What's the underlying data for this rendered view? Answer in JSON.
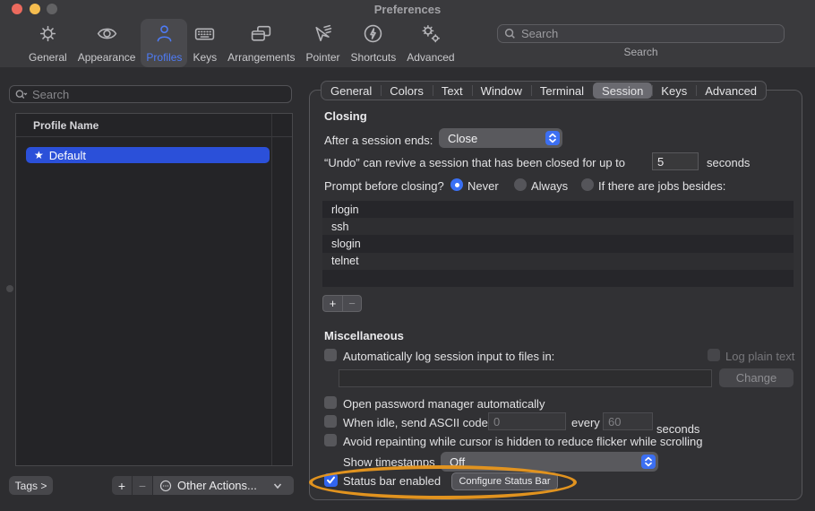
{
  "window": {
    "title": "Preferences"
  },
  "toolbar": {
    "items": [
      {
        "label": "General",
        "icon": "gear-icon",
        "selected": false
      },
      {
        "label": "Appearance",
        "icon": "eye-icon",
        "selected": false
      },
      {
        "label": "Profiles",
        "icon": "person-icon",
        "selected": true
      },
      {
        "label": "Keys",
        "icon": "keyboard-icon",
        "selected": false
      },
      {
        "label": "Arrangements",
        "icon": "windows-icon",
        "selected": false
      },
      {
        "label": "Pointer",
        "icon": "cursor-icon",
        "selected": false
      },
      {
        "label": "Shortcuts",
        "icon": "lightning-icon",
        "selected": false
      },
      {
        "label": "Advanced",
        "icon": "double-gear-icon",
        "selected": false
      }
    ],
    "search": {
      "placeholder": "Search",
      "caption": "Search"
    }
  },
  "sidebar": {
    "search_placeholder": "Search",
    "column_header": "Profile Name",
    "profiles": [
      {
        "star": "★",
        "name": "Default",
        "selected": true
      }
    ],
    "tags_button": "Tags >",
    "add_label": "+",
    "remove_label": "−",
    "other_actions_label": "Other Actions..."
  },
  "panel": {
    "tabs": [
      "General",
      "Colors",
      "Text",
      "Window",
      "Terminal",
      "Session",
      "Keys",
      "Advanced"
    ],
    "selected_tab": "Session",
    "closing": {
      "heading": "Closing",
      "after_label": "After a session ends:",
      "after_value": "Close",
      "undo_text": "“Undo” can revive a session that has been closed for up to",
      "undo_value": "5",
      "undo_suffix": "seconds",
      "prompt_label": "Prompt before closing?",
      "prompt_options": [
        "Never",
        "Always",
        "If there are jobs besides:"
      ],
      "prompt_selected": "Never",
      "jobs": [
        "rlogin",
        "ssh",
        "slogin",
        "telnet"
      ],
      "list_add": "+",
      "list_remove": "−"
    },
    "misc": {
      "heading": "Miscellaneous",
      "auto_log_label": "Automatically log session input to files in:",
      "log_plain_text_label": "Log plain text",
      "log_dir_value": "",
      "change_button": "Change",
      "open_password_label": "Open password manager automatically",
      "when_idle_label": "When idle, send ASCII code",
      "idle_code_value": "0",
      "every_label": "every",
      "idle_seconds_value": "60",
      "seconds_label": "seconds",
      "avoid_repaint_label": "Avoid repainting while cursor is hidden to reduce flicker while scrolling",
      "show_timestamps_label": "Show timestamps",
      "show_timestamps_value": "Off",
      "status_bar_label": "Status bar enabled",
      "status_bar_checked": true,
      "configure_button": "Configure Status Bar"
    }
  },
  "colors": {
    "accent_blue": "#3c6ff2",
    "selection_blue": "#2b50d9",
    "annotation_orange": "#e1931f"
  }
}
